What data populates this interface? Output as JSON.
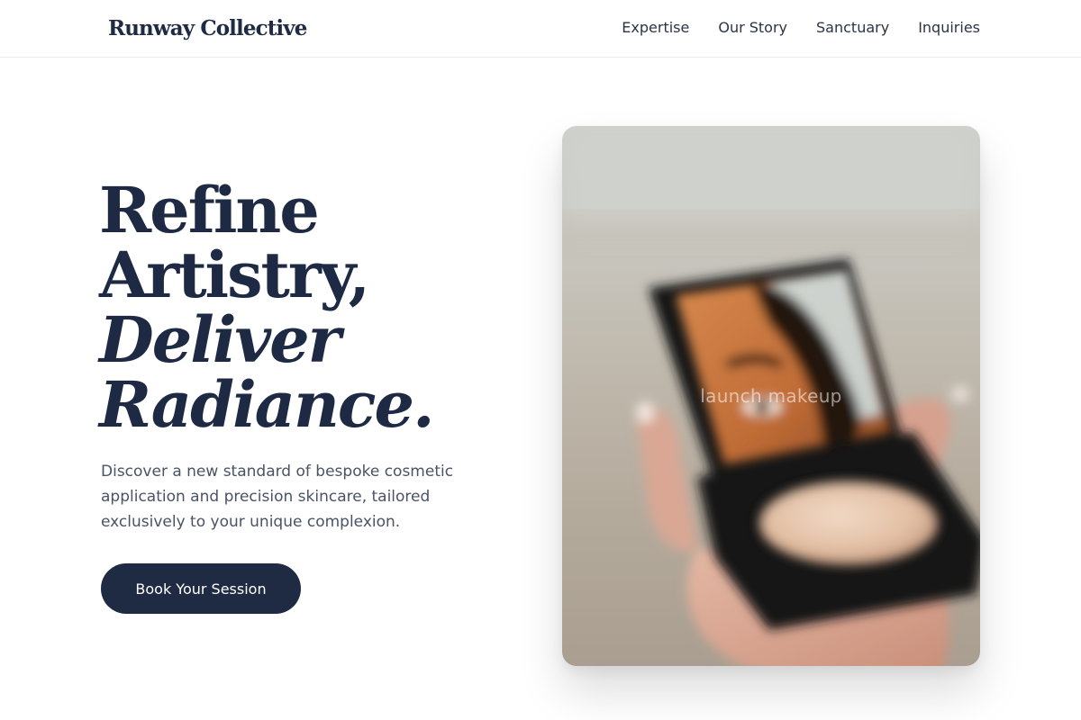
{
  "header": {
    "brand": "Runway Collective",
    "nav": [
      "Expertise",
      "Our Story",
      "Sanctuary",
      "Inquiries"
    ]
  },
  "hero": {
    "title_lines": [
      "Refine",
      "Artistry,",
      "Deliver",
      "Radiance."
    ],
    "description": "Discover a new standard of bespoke cosmetic application and precision skincare, tailored exclusively to your unique complexion.",
    "cta_label": "Book Your Session",
    "image_alt": "launch makeup"
  },
  "colors": {
    "primary": "#1f2a43",
    "body_text": "#4a5366",
    "background": "#ffffff"
  }
}
